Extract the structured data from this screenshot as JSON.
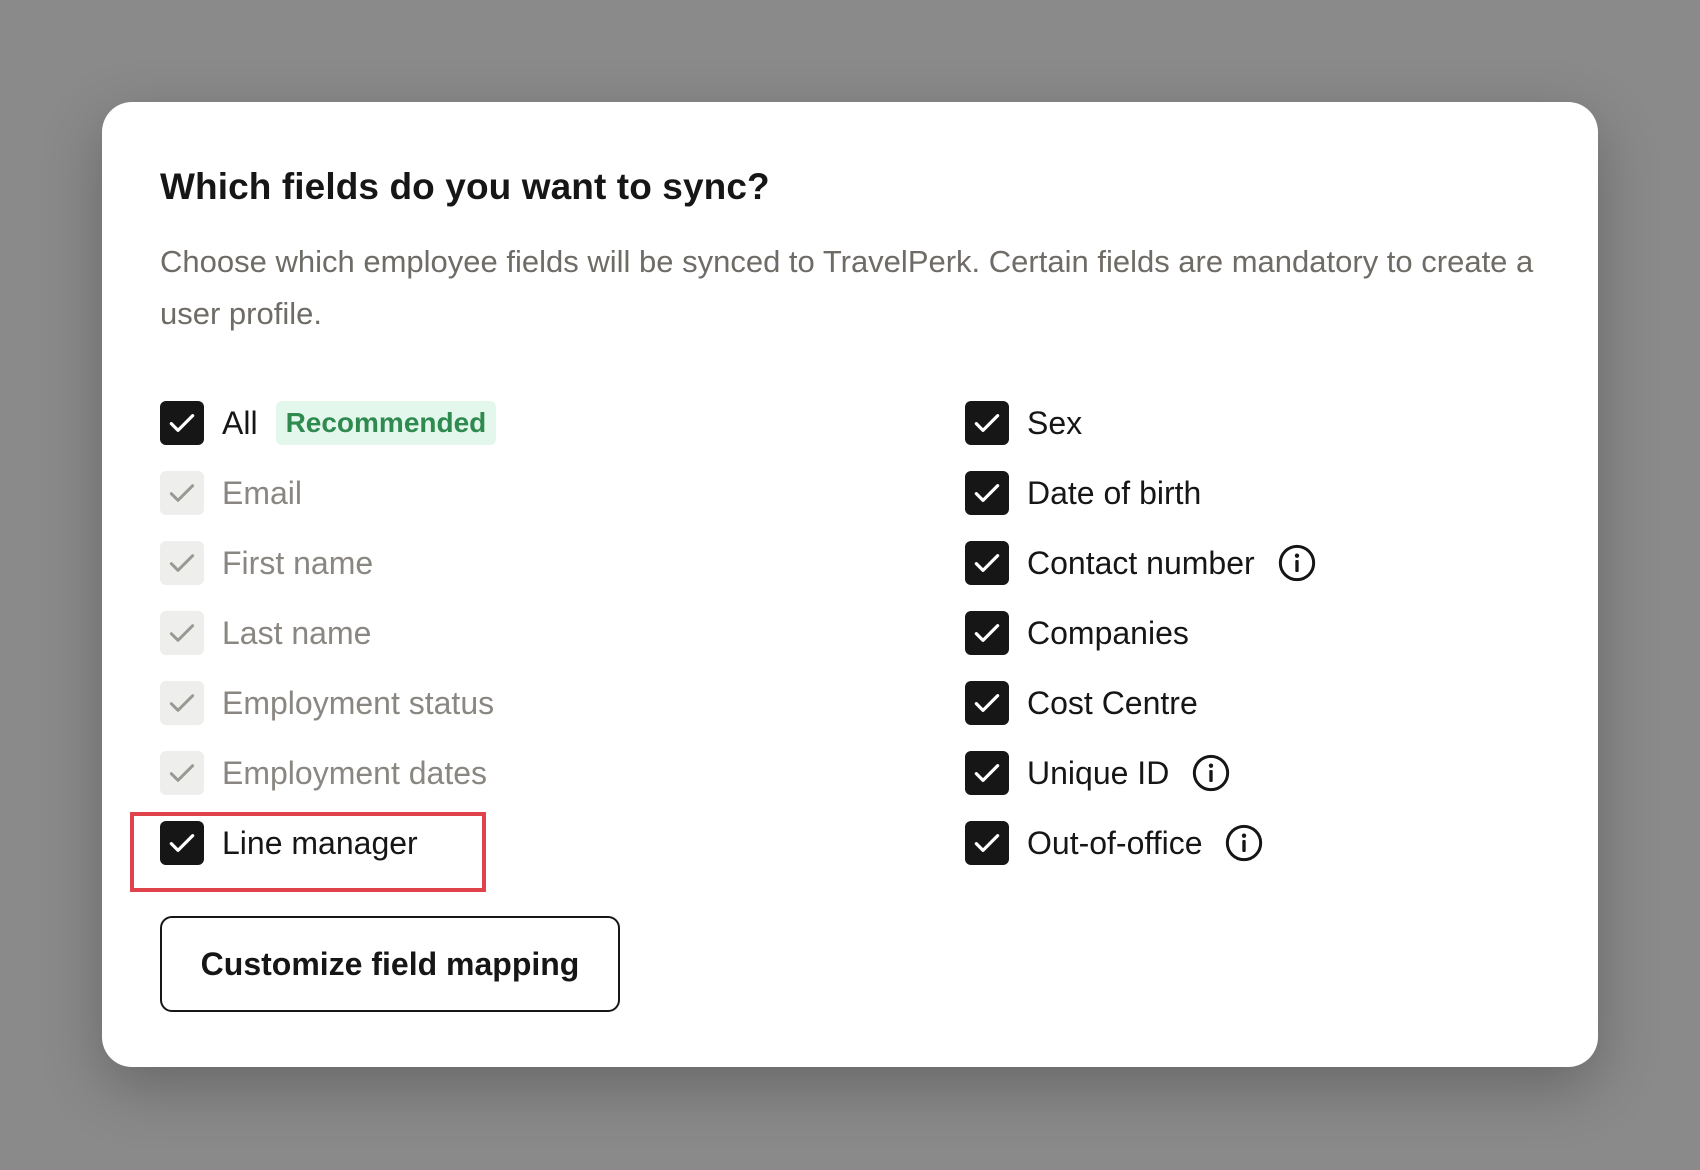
{
  "modal": {
    "title": "Which fields do you want to sync?",
    "subtitle": "Choose which employee fields will be synced to TravelPerk. Certain fields are mandatory to create a user profile.",
    "all": {
      "label": "All",
      "badge": "Recommended",
      "checked": true
    },
    "left_fields": [
      {
        "label": "Email",
        "checked": true,
        "disabled": true
      },
      {
        "label": "First name",
        "checked": true,
        "disabled": true
      },
      {
        "label": "Last name",
        "checked": true,
        "disabled": true
      },
      {
        "label": "Employment status",
        "checked": true,
        "disabled": true
      },
      {
        "label": "Employment dates",
        "checked": true,
        "disabled": true
      },
      {
        "label": "Line manager",
        "checked": true,
        "disabled": false,
        "highlighted": true
      }
    ],
    "right_fields": [
      {
        "label": "Sex",
        "checked": true,
        "info": false
      },
      {
        "label": "Date of birth",
        "checked": true,
        "info": false
      },
      {
        "label": "Contact number",
        "checked": true,
        "info": true,
        "info_icon": "info-icon"
      },
      {
        "label": "Companies",
        "checked": true,
        "info": false
      },
      {
        "label": "Cost Centre",
        "checked": true,
        "info": false
      },
      {
        "label": "Unique ID",
        "checked": true,
        "info": true,
        "info_icon": "info-icon"
      },
      {
        "label": "Out-of-office",
        "checked": true,
        "info": true,
        "info_icon": "info-icon"
      }
    ],
    "customize_button": "Customize field mapping"
  },
  "colors": {
    "checkbox_checked": "#161616",
    "checkbox_disabled": "#eeeeec",
    "badge_bg": "#e4f7ec",
    "badge_text": "#2f8a50",
    "highlight_border": "#e0434b",
    "backdrop": "#8a8a8a"
  }
}
